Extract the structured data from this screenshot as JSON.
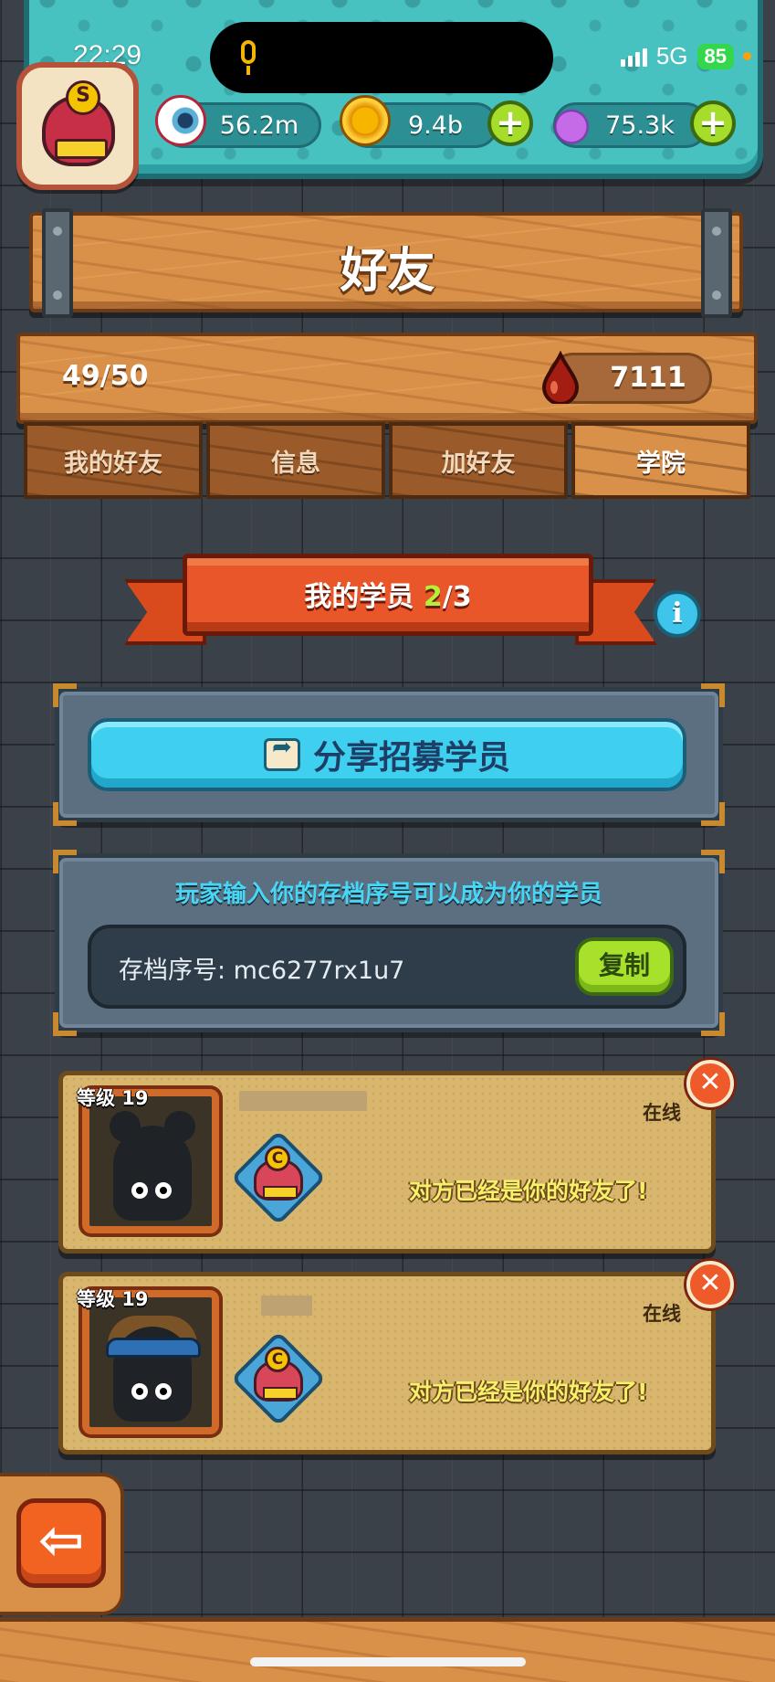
{
  "status_bar": {
    "time": "22:29",
    "network": "5G",
    "battery": "85"
  },
  "resources": {
    "eyes": "56.2m",
    "coins": "9.4b",
    "potions": "75.3k",
    "add_label": "+"
  },
  "header": {
    "title": "好友",
    "friend_count": "49/50",
    "blood": "7111"
  },
  "tabs": [
    {
      "label": "我的好友",
      "active": false
    },
    {
      "label": "信息",
      "active": false
    },
    {
      "label": "加好友",
      "active": false
    },
    {
      "label": "学院",
      "active": true
    }
  ],
  "academy": {
    "ribbon_label": "我的学员 ",
    "ribbon_current": "2",
    "ribbon_total": "/3",
    "info_label": "i",
    "share_label": "分享招募学员",
    "hint": "玩家输入你的存档序号可以成为你的学员",
    "code_label": "存档序号: mc6277rx1u7",
    "copy_label": "复制"
  },
  "students": [
    {
      "level": "等级 19",
      "status": "在线",
      "message": "对方已经是你的好友了!",
      "rank_letter": "C",
      "remove_label": "✕"
    },
    {
      "level": "等级 19",
      "status": "在线",
      "message": "对方已经是你的好友了!",
      "rank_letter": "C",
      "remove_label": "✕"
    }
  ],
  "avatar_badge": "S",
  "back_label": "⇦",
  "colors": {
    "teal_hud": "#47c2c0",
    "wood": "#d9914a",
    "ribbon": "#e8562a",
    "share_button": "#3fd0f0",
    "copy_button": "#a8e12c",
    "highlight_green": "#b4f03a",
    "hint_cyan": "#47d6f5",
    "message_yellow": "#f7f06a"
  }
}
